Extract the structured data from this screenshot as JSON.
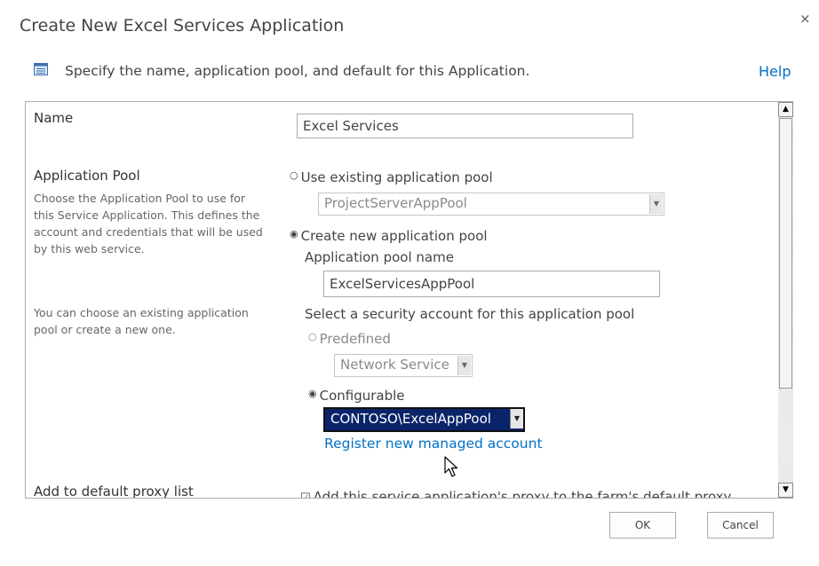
{
  "dialog": {
    "title": "Create New Excel Services Application",
    "close_glyph": "×",
    "intro": "Specify the name, application pool, and default for this Application.",
    "help_label": "Help"
  },
  "form": {
    "name_section": {
      "title": "Name",
      "value": "Excel Services"
    },
    "app_pool_section": {
      "title": "Application Pool",
      "desc1": "Choose the Application Pool to use for this Service Application.  This defines the account and credentials that will be used by this web service.",
      "desc2": "You can choose an existing application pool or create a new one.",
      "use_existing_label": "Use existing application pool",
      "existing_pool_value": "ProjectServerAppPool",
      "create_new_label": "Create new application pool",
      "pool_name_label": "Application pool name",
      "pool_name_value": "ExcelServicesAppPool",
      "security_label": "Select a security account for this application pool",
      "predefined_label": "Predefined",
      "predefined_value": "Network Service",
      "configurable_label": "Configurable",
      "configurable_value": "CONTOSO\\ExcelAppPool",
      "register_link": "Register new managed account"
    },
    "proxy_section": {
      "title": "Add to default proxy list",
      "checkbox_label": "Add this service application's proxy to the farm's default proxy"
    }
  },
  "buttons": {
    "ok": "OK",
    "cancel": "Cancel"
  },
  "colors": {
    "link": "#0072c6",
    "selected_bg": "#0a246a"
  }
}
